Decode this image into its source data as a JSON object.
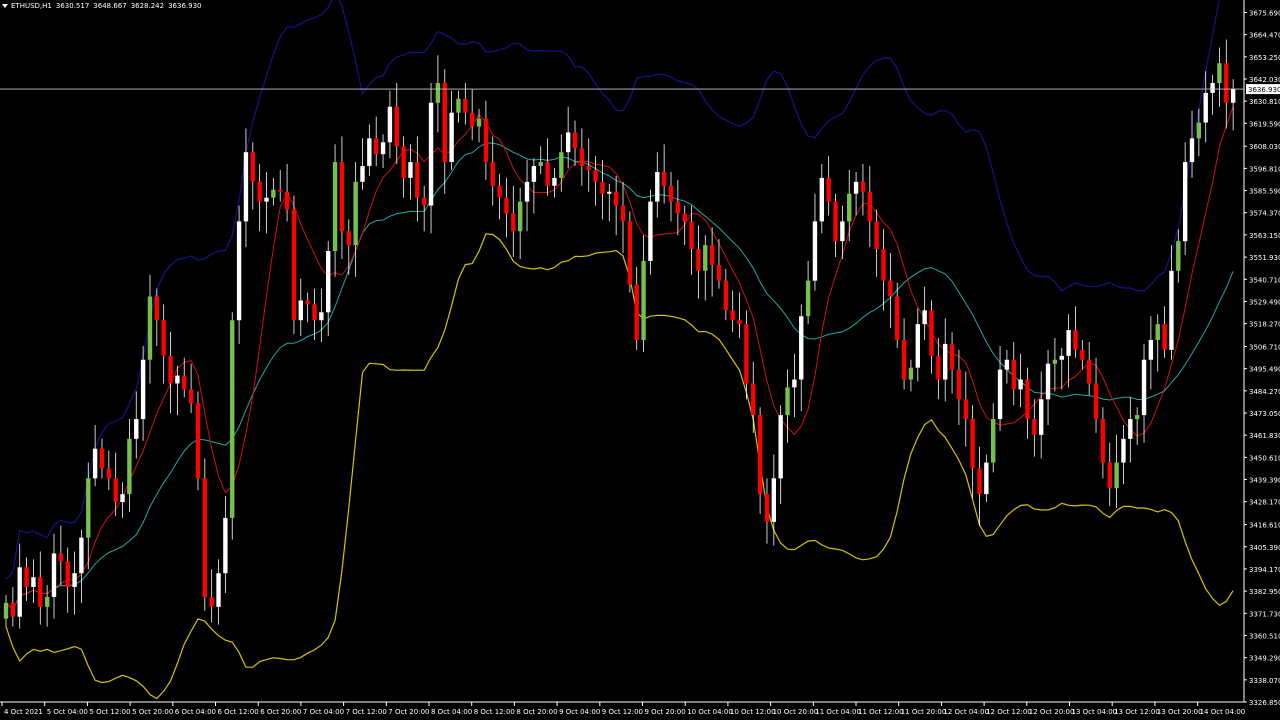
{
  "header": {
    "symbol": "ETHUSD,H1",
    "open": "3630.517",
    "high": "3648.667",
    "low": "3628.242",
    "close": "3636.930"
  },
  "colors": {
    "background": "#000000",
    "bull_body": "#ffffff",
    "bull_body_alt": "#74c24a",
    "bear_body": "#ff0000",
    "wick": "#ffffff",
    "ma_fast": "#d01010",
    "ma_slow": "#20a8a8",
    "bb_upper": "#14148a",
    "bb_lower": "#d8c400",
    "axis_text": "#ffffff",
    "price_line": "#c8c8c8",
    "price_tag_bg": "#ffffff",
    "price_tag_text": "#000000"
  },
  "chart_data": {
    "type": "candlestick",
    "title": "ETHUSD,H1",
    "y_ticks": [
      "3675.690",
      "3664.470",
      "3653.250",
      "3642.030",
      "3630.810",
      "3619.590",
      "3608.030",
      "3596.810",
      "3585.590",
      "3574.370",
      "3563.150",
      "3551.930",
      "3540.710",
      "3529.490",
      "3518.270",
      "3506.710",
      "3495.490",
      "3484.270",
      "3473.050",
      "3461.830",
      "3450.610",
      "3439.390",
      "3428.170",
      "3416.610",
      "3405.390",
      "3394.170",
      "3382.950",
      "3371.730",
      "3360.510",
      "3349.290",
      "3338.070",
      "3326.850"
    ],
    "x_ticks": [
      "4 Oct 2021",
      "5 Oct 04:00",
      "5 Oct 12:00",
      "5 Oct 20:00",
      "6 Oct 04:00",
      "6 Oct 12:00",
      "6 Oct 20:00",
      "7 Oct 04:00",
      "7 Oct 12:00",
      "7 Oct 20:00",
      "8 Oct 04:00",
      "8 Oct 12:00",
      "8 Oct 20:00",
      "9 Oct 04:00",
      "9 Oct 12:00",
      "9 Oct 20:00",
      "10 Oct 04:00",
      "10 Oct 12:00",
      "10 Oct 20:00",
      "11 Oct 04:00",
      "11 Oct 12:00",
      "11 Oct 20:00",
      "12 Oct 04:00",
      "12 Oct 12:00",
      "12 Oct 20:00",
      "13 Oct 04:00",
      "13 Oct 12:00",
      "13 Oct 20:00",
      "14 Oct 04:00"
    ],
    "ylim": [
      3326.85,
      3682.0
    ],
    "current_price": "3636.930",
    "series": [
      {
        "kind": "close",
        "values": [
          3377,
          3370,
          3395,
          3385,
          3390,
          3375,
          3380,
          3402,
          3398,
          3385,
          3392,
          3410,
          3440,
          3455,
          3445,
          3440,
          3428,
          3432,
          3460,
          3470,
          3500,
          3532,
          3520,
          3502,
          3488,
          3492,
          3485,
          3478,
          3440,
          3380,
          3375,
          3392,
          3420,
          3520,
          3570,
          3605,
          3590,
          3580,
          3582,
          3586,
          3585,
          3576,
          3520,
          3530,
          3528,
          3520,
          3524,
          3555,
          3600,
          3565,
          3558,
          3590,
          3598,
          3612,
          3604,
          3610,
          3628,
          3608,
          3592,
          3600,
          3582,
          3578,
          3630,
          3640,
          3600,
          3625,
          3632,
          3625,
          3618,
          3622,
          3600,
          3588,
          3582,
          3574,
          3565,
          3580,
          3590,
          3598,
          3600,
          3588,
          3592,
          3605,
          3615,
          3607,
          3598,
          3596,
          3590,
          3584,
          3585,
          3578,
          3570,
          3538,
          3510,
          3550,
          3580,
          3595,
          3588,
          3580,
          3574,
          3570,
          3556,
          3545,
          3558,
          3548,
          3540,
          3525,
          3520,
          3518,
          3488,
          3472,
          3432,
          3418,
          3440,
          3472,
          3486,
          3490,
          3522,
          3540,
          3570,
          3592,
          3580,
          3560,
          3570,
          3584,
          3590,
          3585,
          3570,
          3556,
          3540,
          3532,
          3510,
          3490,
          3496,
          3518,
          3525,
          3502,
          3490,
          3508,
          3495,
          3480,
          3470,
          3445,
          3432,
          3448,
          3470,
          3495,
          3500,
          3485,
          3490,
          3470,
          3462,
          3480,
          3498,
          3500,
          3502,
          3515,
          3505,
          3500,
          3488,
          3470,
          3448,
          3435,
          3448,
          3460,
          3470,
          3472,
          3500,
          3510,
          3518,
          3505,
          3545,
          3560,
          3600,
          3612,
          3620,
          3635,
          3640,
          3650,
          3630,
          3637
        ]
      }
    ]
  }
}
